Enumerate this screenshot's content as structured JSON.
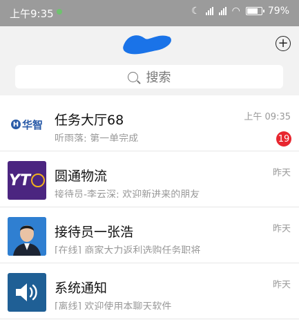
{
  "status_bar": {
    "time": "上午9:35",
    "battery": "79%"
  },
  "header": {
    "title": "",
    "plus_icon": "plus-icon",
    "search": {
      "placeholder": "搜索",
      "icon": "search-icon"
    }
  },
  "conversations": [
    {
      "name": "任务大厅68",
      "preview": "听雨落: 第一单完成",
      "time": "上午 09:35",
      "unread": "19",
      "avatar": "huazhi-logo",
      "logo_text": "华智"
    },
    {
      "name": "圆通物流",
      "preview": "接待员-李云深: 欢迎新进来的朋友",
      "time": "昨天",
      "avatar": "yto-logo",
      "logo_text": "YT"
    },
    {
      "name": "接待员一张浩",
      "preview": "[在线] 商家大力返利选购任务职将",
      "time": "昨天",
      "avatar": "person-photo"
    },
    {
      "name": "系统通知",
      "preview": "[离线] 欢迎使用本聊天软件",
      "time": "昨天",
      "avatar": "speaker-icon"
    }
  ],
  "colors": {
    "status_bg": "#9b9b9b",
    "header_bg": "#f2f2f2",
    "badge": "#e8262f",
    "yto_purple": "#4b2580",
    "sys_blue": "#1f5f95"
  }
}
